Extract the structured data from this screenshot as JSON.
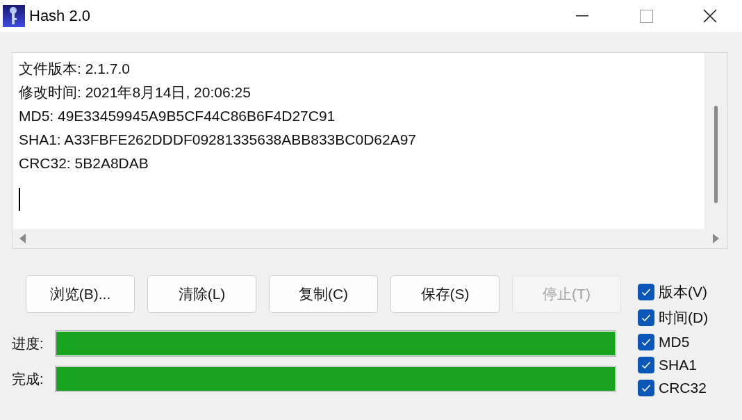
{
  "window": {
    "title": "Hash 2.0"
  },
  "output": {
    "lines": [
      "文件版本: 2.1.7.0",
      "修改时间: 2021年8月14日, 20:06:25",
      "MD5: 49E33459945A9B5CF44C86B6F4D27C91",
      "SHA1: A33FBFE262DDDF09281335638ABB833BC0D62A97",
      "CRC32: 5B2A8DAB"
    ]
  },
  "buttons": [
    {
      "label": "浏览(B)...",
      "disabled": false
    },
    {
      "label": "清除(L)",
      "disabled": false
    },
    {
      "label": "复制(C)",
      "disabled": false
    },
    {
      "label": "保存(S)",
      "disabled": false
    },
    {
      "label": "停止(T)",
      "disabled": true
    }
  ],
  "progress": [
    {
      "label": "进度:",
      "level": 1
    },
    {
      "label": "完成:",
      "level": 1
    }
  ],
  "options": [
    {
      "label": "版本(V)",
      "checked": true
    },
    {
      "label": "时间(D)",
      "checked": true
    },
    {
      "label": "MD5",
      "checked": true
    },
    {
      "label": "SHA1",
      "checked": true
    },
    {
      "label": "CRC32",
      "checked": true
    }
  ]
}
